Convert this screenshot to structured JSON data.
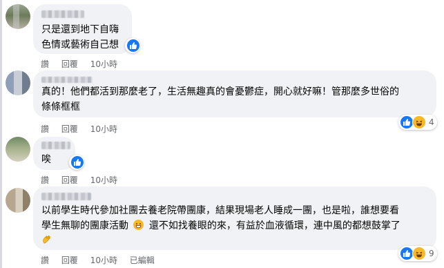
{
  "actions": {
    "like": "讚",
    "reply": "回覆",
    "edited": "已編輯"
  },
  "colors": {
    "like_blue": "#1877f2",
    "haha_yellow": "#f7b928",
    "bubble_bg": "#f0f2f5",
    "meta_gray": "#65676b"
  },
  "comments": [
    {
      "lines": [
        "只是還到地下自嗨",
        "色情或藝術自己想"
      ],
      "time": "",
      "reactions": [
        "like-icon"
      ],
      "reaction_count": ""
    },
    {
      "lines": [
        "真的！他們都活到那麼老了，生活無趣真的會憂鬱症，開心就好嘛！管那麼多世俗的",
        "條條框框"
      ],
      "time": "10小時",
      "reactions": [
        "like-icon",
        "haha-icon"
      ],
      "reaction_count": "4"
    },
    {
      "lines": [
        "唉"
      ],
      "time": "10小時",
      "reactions": [
        "like-icon"
      ],
      "reaction_count": ""
    },
    {
      "lines": [
        "以前學生時代參加社團去養老院帶團康，結果現場老人睡成一團，也是啦，誰想要看",
        "學生無聊的團康活動",
        "還不如找養眼的來，有益於血液循環，連中風的都想鼓掌了"
      ],
      "time": "10小時",
      "reactions": [
        "like-icon",
        "haha-icon"
      ],
      "reaction_count": "9"
    }
  ],
  "first_actions_time": "10小時"
}
